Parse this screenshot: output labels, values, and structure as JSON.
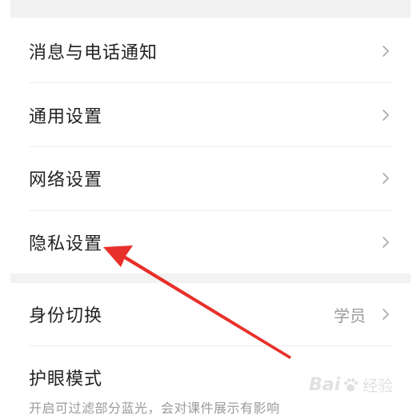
{
  "settings": {
    "items": [
      {
        "label": "消息与电话通知"
      },
      {
        "label": "通用设置"
      },
      {
        "label": "网络设置"
      },
      {
        "label": "隐私设置"
      }
    ],
    "identity": {
      "label": "身份切换",
      "value": "学员"
    },
    "eye_mode": {
      "label": "护眼模式",
      "description": "开启可过滤部分蓝光，会对课件展示有影响"
    }
  },
  "annotation": {
    "arrow_color": "#e8302a"
  },
  "watermark": {
    "brand": "Bai",
    "suffix": "经验"
  }
}
